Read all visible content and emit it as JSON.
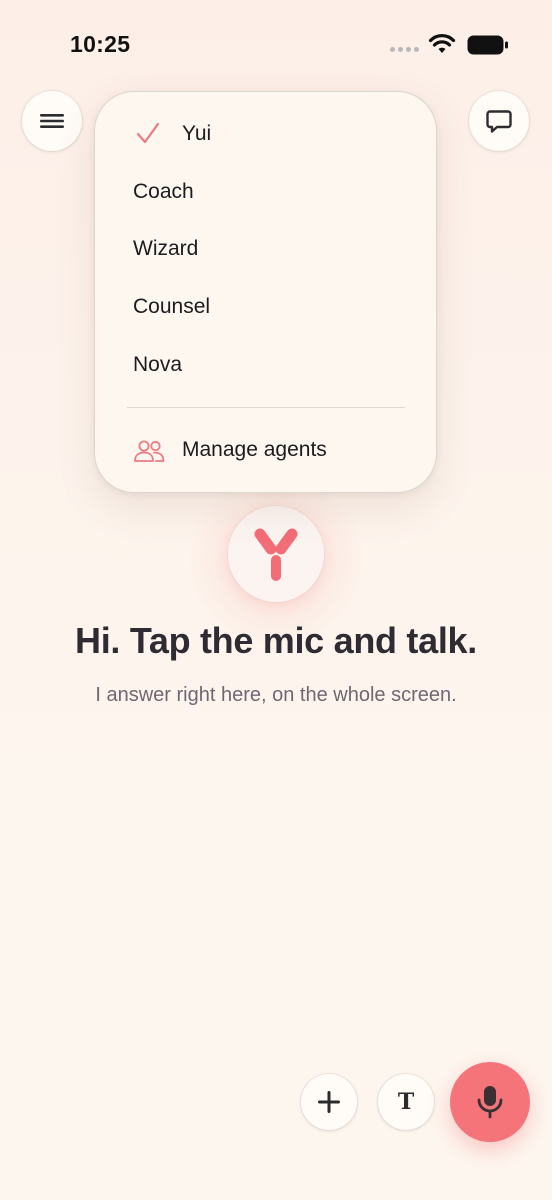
{
  "status_bar": {
    "time": "10:25"
  },
  "header": {
    "menu_icon": "hamburger-icon",
    "chat_icon": "chat-bubble-icon"
  },
  "agent_menu": {
    "items": [
      {
        "label": "Yui",
        "selected": true
      },
      {
        "label": "Coach",
        "selected": false
      },
      {
        "label": "Wizard",
        "selected": false
      },
      {
        "label": "Counsel",
        "selected": false
      },
      {
        "label": "Nova",
        "selected": false
      }
    ],
    "manage_label": "Manage agents",
    "manage_icon": "people-icon"
  },
  "main": {
    "headline": "Hi. Tap the mic and talk.",
    "subline": "I answer right here, on the whole screen."
  },
  "controls": {
    "plus_icon": "plus-icon",
    "text_button_label": "T",
    "mic_icon": "microphone-icon"
  },
  "colors": {
    "accent": "#f57479",
    "background": "#fdf5ee"
  }
}
